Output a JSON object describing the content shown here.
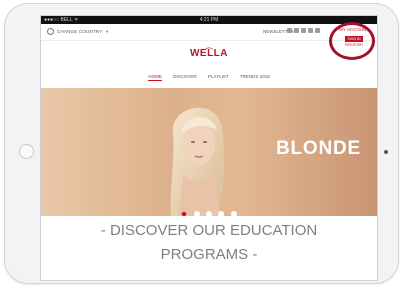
{
  "status_bar": {
    "carrier": "●●●○○ BELL ᯤ",
    "time": "4:21 PM"
  },
  "top_bar": {
    "change_country": "CHANGE COUNTRY",
    "newsletter": "NEWSLETTER",
    "login_label": "MY ACCOUNT",
    "sign_in": "SIGN IN",
    "register": "REGISTER"
  },
  "brand": {
    "logo": "WELLA",
    "color": "#c0102a"
  },
  "nav": {
    "items": [
      "HOME",
      "DISCOVER",
      "PLAYLIST",
      "TRENDS 2018"
    ],
    "active_index": 0
  },
  "hero": {
    "title": "BLONDE",
    "dots_count": 5,
    "active_dot": 0
  },
  "promo": {
    "line1": "- DISCOVER OUR EDUCATION",
    "line2": "PROGRAMS -"
  }
}
